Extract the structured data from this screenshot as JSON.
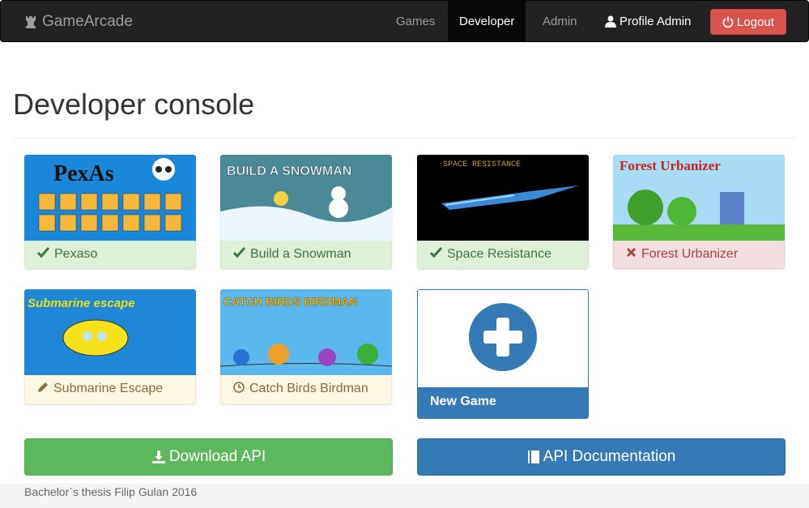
{
  "navbar": {
    "brand": "GameArcade",
    "brand_icon": "rook-icon",
    "items": [
      "Games",
      "Developer",
      "Admin"
    ],
    "active_item": "Developer",
    "profile_label": "Profile Admin",
    "logout_label": "Logout"
  },
  "page": {
    "title": "Developer console"
  },
  "games": [
    {
      "name": "Pexaso",
      "status": "approved",
      "status_icon": "check-icon",
      "thumb_title": "PexAs"
    },
    {
      "name": "Build a Snowman",
      "status": "approved",
      "status_icon": "check-icon",
      "thumb_title": "BUILD A SNOWMAN"
    },
    {
      "name": "Space Resistance",
      "status": "approved",
      "status_icon": "check-icon",
      "thumb_title": "SPACE RESISTANCE"
    },
    {
      "name": "Forest Urbanizer",
      "status": "rejected",
      "status_icon": "times-icon",
      "thumb_title": "Forest Urbanizer"
    },
    {
      "name": "Submarine Escape",
      "status": "in-progress",
      "status_icon": "pencil-icon",
      "thumb_title": "Submarine escape"
    },
    {
      "name": "Catch Birds Birdman",
      "status": "pending",
      "status_icon": "clock-icon",
      "thumb_title": "CATCH BIRDS BIRDMAN"
    }
  ],
  "new_game": {
    "label": "New Game"
  },
  "actions": {
    "download_api": "Download API",
    "api_docs": "API Documentation"
  },
  "footer": {
    "text": "Bachelor`s thesis Filip Gulan 2016"
  },
  "colors": {
    "success": "#5cb85c",
    "primary": "#337ab7",
    "danger": "#d9534f",
    "navbar": "#222222"
  }
}
